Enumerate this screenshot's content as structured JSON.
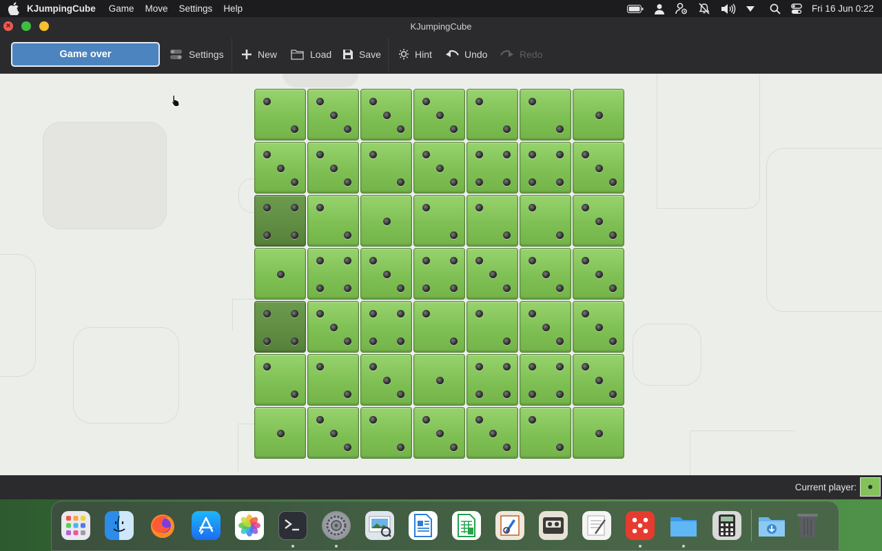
{
  "menubar": {
    "app_name": "KJumpingCube",
    "menus": [
      "Game",
      "Move",
      "Settings",
      "Help"
    ],
    "clock": "Fri 16 Jun 0:22"
  },
  "window": {
    "title": "KJumpingCube"
  },
  "toolbar": {
    "status": "Game over",
    "settings_label": "Settings",
    "new_label": "New",
    "load_label": "Load",
    "save_label": "Save",
    "hint_label": "Hint",
    "undo_label": "Undo",
    "redo_label": "Redo",
    "redo_enabled": false
  },
  "board": {
    "size": 7,
    "owner_color": "#82c259",
    "cells": [
      [
        2,
        3,
        3,
        3,
        2,
        2,
        1
      ],
      [
        3,
        3,
        2,
        3,
        4,
        4,
        3
      ],
      [
        4,
        2,
        1,
        2,
        2,
        2,
        3
      ],
      [
        1,
        4,
        3,
        4,
        3,
        3,
        3
      ],
      [
        4,
        3,
        4,
        2,
        2,
        3,
        3
      ],
      [
        2,
        2,
        3,
        1,
        4,
        4,
        3
      ],
      [
        1,
        3,
        2,
        3,
        3,
        2,
        1
      ]
    ],
    "highlighted": [
      [
        2,
        0
      ],
      [
        4,
        0
      ]
    ]
  },
  "statusbar": {
    "current_player_label": "Current player:"
  },
  "dock": {
    "apps": [
      "launchpad-icon",
      "finder-icon",
      "firefox-icon",
      "app-store-icon",
      "photos-icon",
      "terminal-icon",
      "system-settings-icon",
      "preview-icon",
      "writer-icon",
      "calc-sheet-icon",
      "draw-icon",
      "tape-icon",
      "text-editor-icon",
      "kjumpingcube-icon",
      "files-icon",
      "calculator-icon",
      "downloads-icon",
      "trash-icon"
    ],
    "running": [
      "terminal-icon",
      "system-settings-icon",
      "kjumpingcube-icon",
      "files-icon"
    ]
  }
}
